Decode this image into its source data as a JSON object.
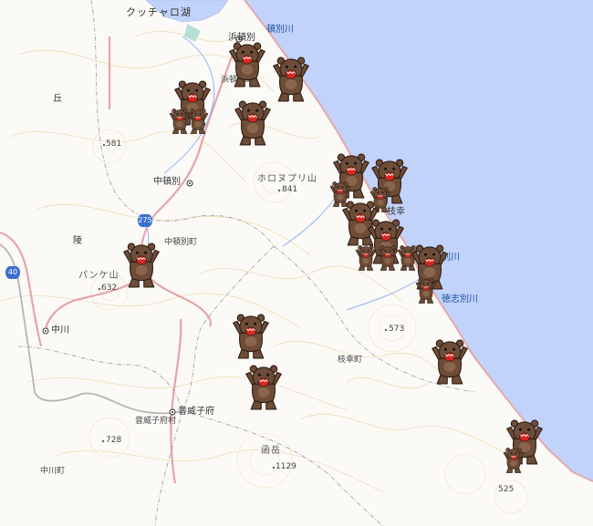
{
  "map": {
    "colors": {
      "sea": "#c2d3fb",
      "land": "#fbfaf7",
      "coast": "#e7a6aa",
      "road": "#e6a4a8",
      "contour": "#ead9a9",
      "admin": "#9a9a9a"
    },
    "place_labels": {
      "kuccharo": "クッチャロ湖",
      "hamatonbetsu_station": "浜頓別",
      "hamatonbetsu_town": "浜頓別町",
      "nakatonbetsu_station": "中頓別",
      "nakatonbetsu_town": "中頓別町",
      "esashi": "枝幸",
      "esashi_town": "枝幸町",
      "nakagawa": "中川",
      "nakagawa_town": "中川町",
      "otoineppu": "音威子府",
      "otoineppu_village": "音威子府村",
      "oka": "丘",
      "ryo": "陵",
      "horonupuri": "ホロヌプリ山",
      "panke": "パンケ山",
      "mount_south": "函岳"
    },
    "rivers": {
      "tonbetsu": "頓別川",
      "horobetsu": "幌別川",
      "tokushibetsu": "徳志別川"
    },
    "elevations": {
      "e581": "581",
      "e841": "841",
      "e632": "632",
      "e573": "573",
      "e728": "728",
      "e1129": "1129",
      "e525": "525"
    },
    "routes": {
      "r275": "275",
      "r40": "40"
    },
    "bear_icon": "brown-bear-icon",
    "bear_count": 26
  }
}
